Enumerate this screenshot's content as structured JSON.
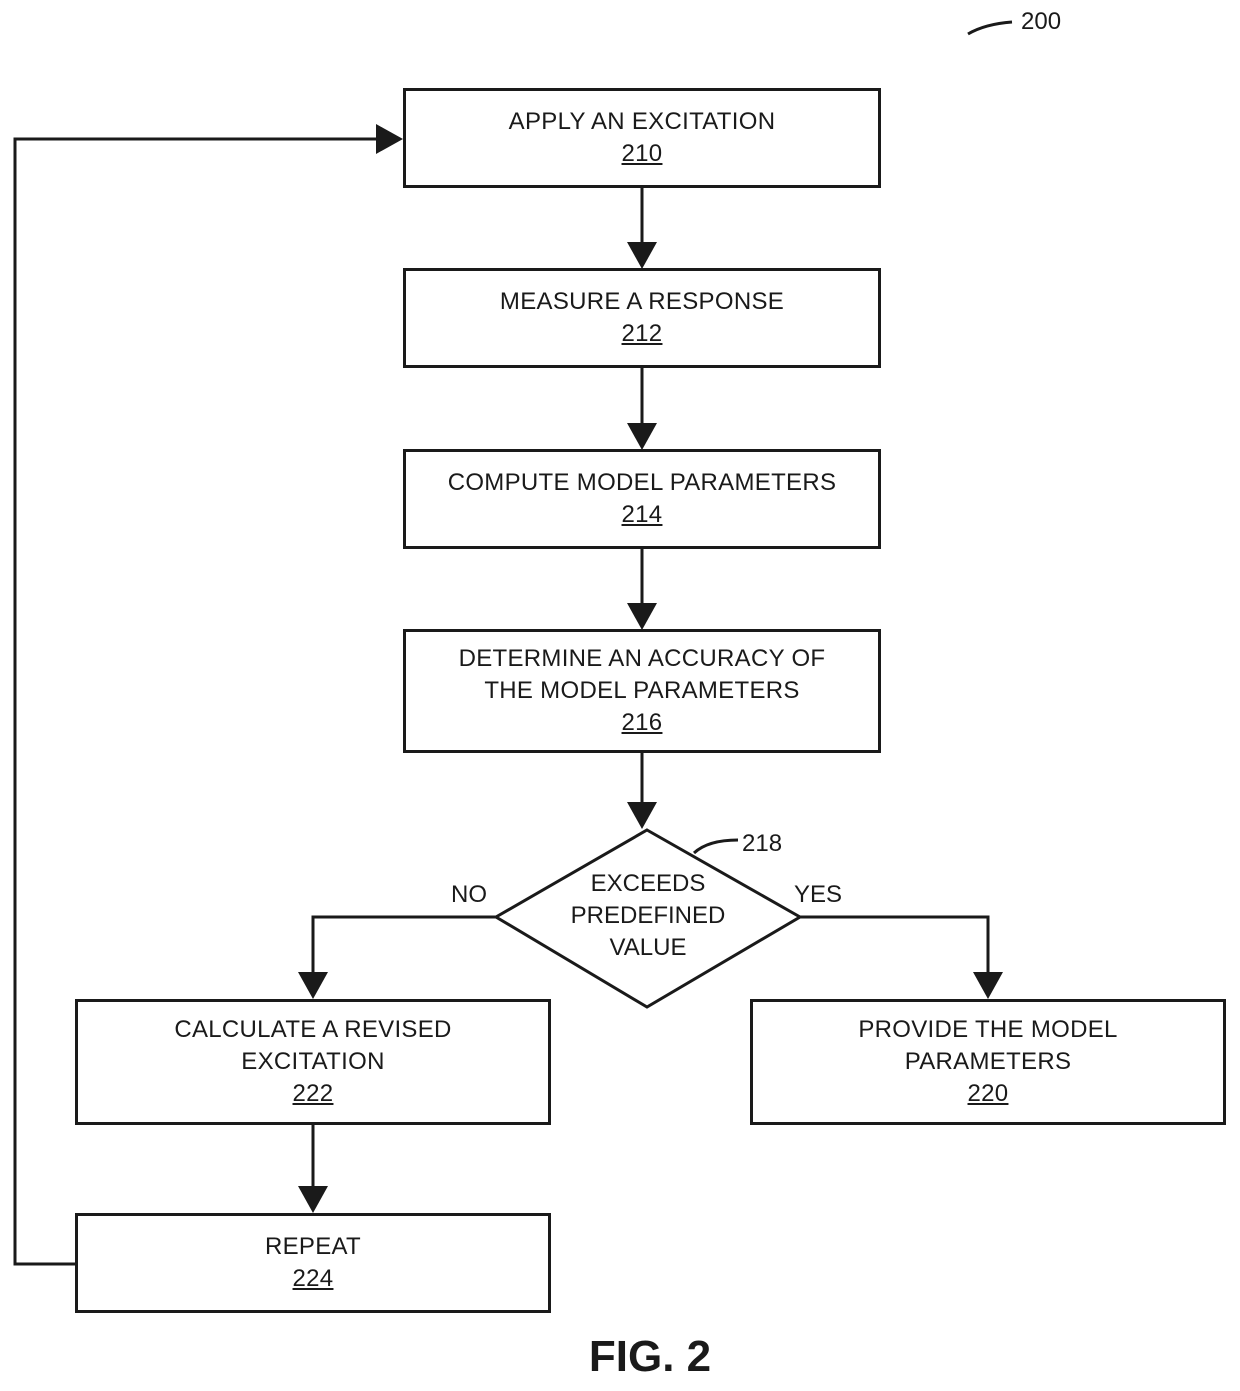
{
  "figure": {
    "ref": "200",
    "caption": "FIG. 2"
  },
  "steps": {
    "apply": {
      "label": "APPLY AN EXCITATION",
      "ref": "210"
    },
    "measure": {
      "label": "MEASURE A RESPONSE",
      "ref": "212"
    },
    "compute": {
      "label": "COMPUTE MODEL PARAMETERS",
      "ref": "214"
    },
    "determine": {
      "line1": "DETERMINE AN ACCURACY OF",
      "line2": "THE MODEL PARAMETERS",
      "ref": "216"
    },
    "decision": {
      "line1": "EXCEEDS",
      "line2": "PREDEFINED",
      "line3": "VALUE",
      "ref": "218"
    },
    "provide": {
      "line1": "PROVIDE THE MODEL",
      "line2": "PARAMETERS",
      "ref": "220"
    },
    "revise": {
      "line1": "CALCULATE A REVISED",
      "line2": "EXCITATION",
      "ref": "222"
    },
    "repeat": {
      "label": "REPEAT",
      "ref": "224"
    }
  },
  "branches": {
    "no": "NO",
    "yes": "YES"
  }
}
